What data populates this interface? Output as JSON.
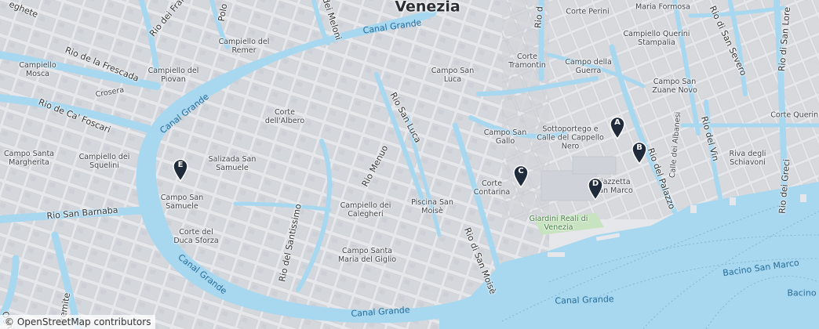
{
  "map": {
    "city": "Venezia",
    "attribution": "© OpenStreetMap contributors",
    "colors": {
      "water": "#a8d8f0",
      "land": "#e4e5e8",
      "blocks": "#d3d5da",
      "park": "#c8e3c0",
      "marker": "#1f2a3a"
    },
    "labels": {
      "canal_grande_top": "Canal Grande",
      "canal_grande_left": "Canal Grande",
      "canal_grande_bottom_left": "Canal Grande",
      "canal_grande_bottom_mid": "Canal Grande",
      "canal_grande_bottom_right": "Canal Grande",
      "bacino": "Bacino San Marco",
      "bacino2": "Bacino",
      "rio_frescada": "Rio de la Frescada",
      "rio_ca_foscari": "Rio de Ca' Foscari",
      "rio_barnaba": "Rio San Barnaba",
      "rio_menuo": "Rio Menuo",
      "rio_san_luca": "Rio San Luca",
      "rio_santissimo": "Rio del Santissimo",
      "rio_san_moise": "Rio di San Moisè",
      "rio_palazzo": "Rio del Palazzo",
      "rio_vin": "Rio del Vin",
      "rio_greci": "Rio dei Greci",
      "rio_lore": "Rio di San Lore",
      "rio_severo": "Rio di San Severo",
      "rio_meloni": "Rio dei Meloni",
      "rio_frari": "Rio dei Frari",
      "rio_eghete": "eghete",
      "rio_top1": "Rio d",
      "rio_polo": "Polo",
      "rio_eremite": "Eremite",
      "rio_ogni": "Ogni",
      "campiello_remer": "Campiello del Remer",
      "campiello_piovan": "Campiello del Piovan",
      "campiello_mosca": "Campiello Mosca",
      "crosera": "Crosera",
      "campo_santa_margherita": "Campo Santa Margherita",
      "campiello_squelini": "Campiello dei Squelini",
      "corte_albero": "Corte dell'Albero",
      "salizada_samuele": "Salizada San Samuele",
      "campo_san_samuele": "Campo San Samuele",
      "corte_duca_sforza": "Corte del Duca Sforza",
      "campiello_calegheri": "Campiello dei Calegheri",
      "campo_santa_maria_giglio": "Campo Santa Maria del Giglio",
      "piscina_san_moise": "Piscina San Moisè",
      "corte_contarina": "Corte Contarina",
      "campo_san_gallo": "Campo San Gallo",
      "sottoportego": "Sottoportego e Calle del Cappello Nero",
      "campo_san_luca": "Campo San Luca",
      "corte_tramontin": "Corte Tramontin",
      "campo_guerra": "Campo della Guerra",
      "corte_perini": "Corte Perini",
      "maria_formosa": "Maria Formosa",
      "campiello_querini": "Campiello Querini Stampalia",
      "campo_zuane": "Campo San Zuane Novo",
      "corte_querini": "Corte Querini",
      "calle_albanesi": "Calle dei Albanesi",
      "riva_schiavoni": "Riva degli Schiavoni",
      "piazzetta": "Piazzetta San Marco",
      "giardini": "Giardini Reali di Venezia"
    },
    "markers": [
      {
        "id": "A",
        "label": "A"
      },
      {
        "id": "B",
        "label": "B"
      },
      {
        "id": "C",
        "label": "C"
      },
      {
        "id": "D",
        "label": "D"
      },
      {
        "id": "E",
        "label": "E"
      }
    ]
  }
}
